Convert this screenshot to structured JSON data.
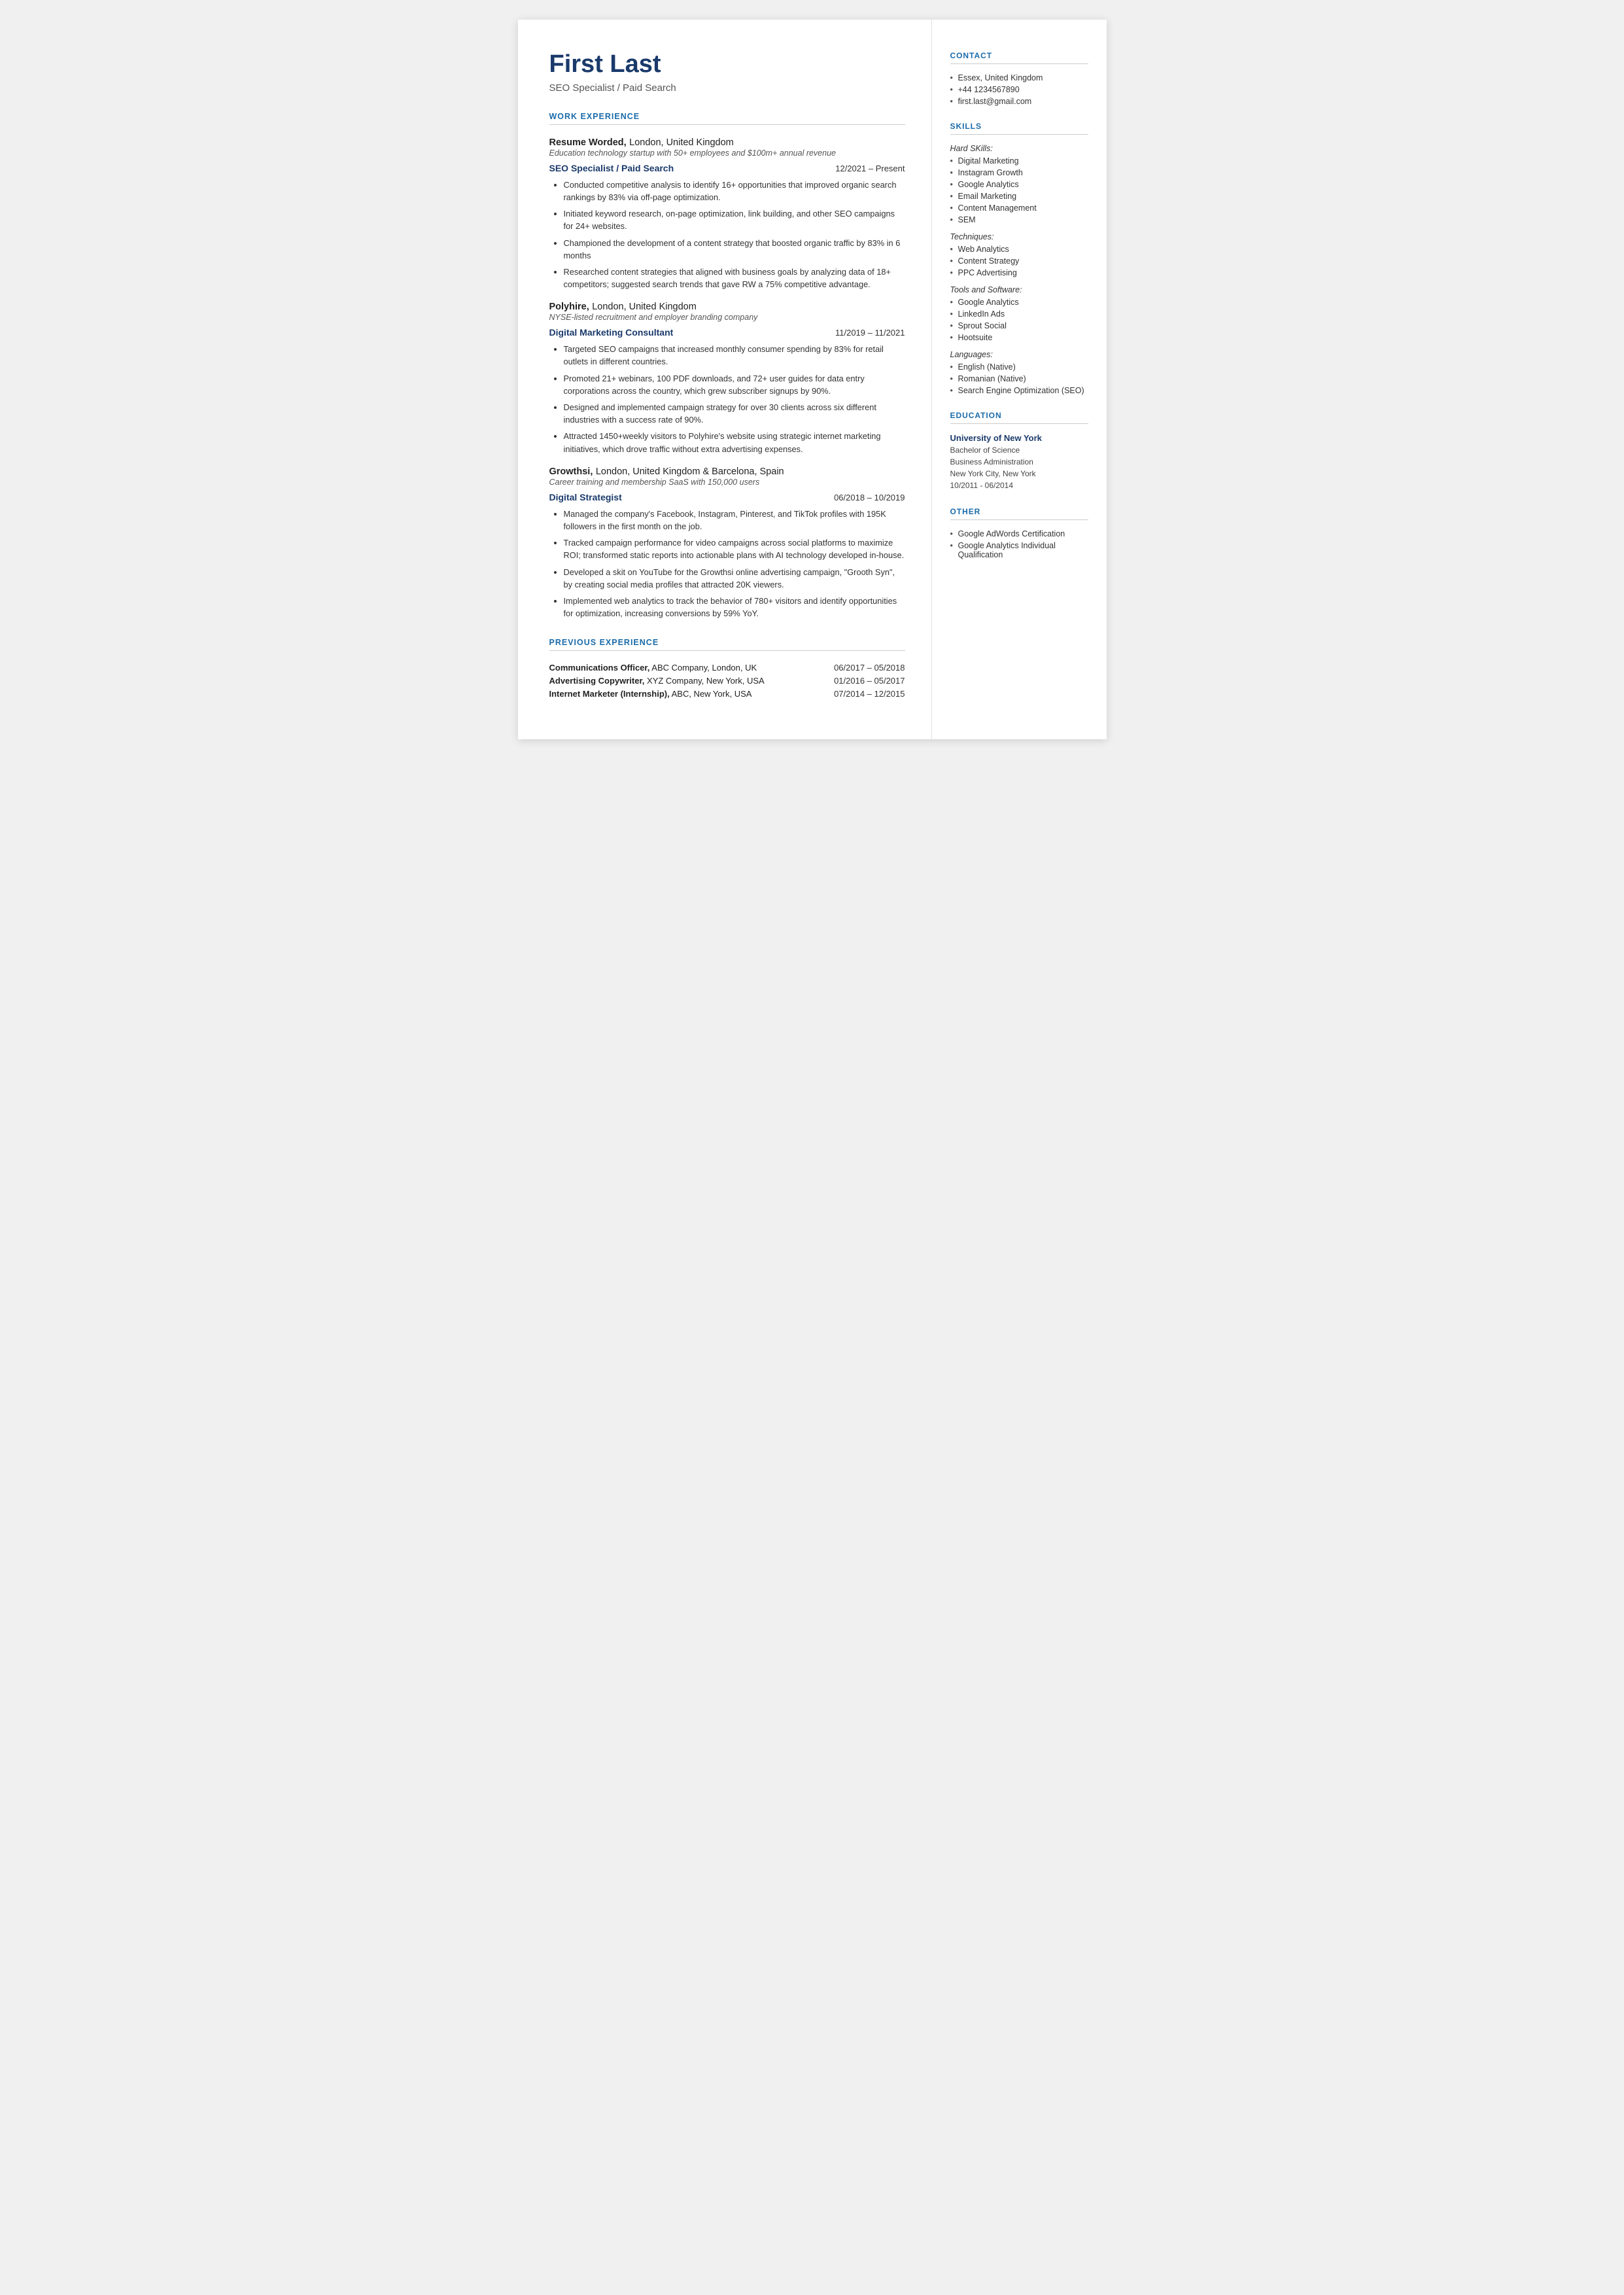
{
  "header": {
    "name": "First Last",
    "job_title": "SEO Specialist / Paid Search"
  },
  "sections": {
    "work_experience_label": "WORK EXPERIENCE",
    "previous_experience_label": "PREVIOUS EXPERIENCE"
  },
  "companies": [
    {
      "name": "Resume Worded,",
      "location": " London, United Kingdom",
      "description": "Education technology startup with 50+ employees and $100m+ annual revenue",
      "roles": [
        {
          "title": "SEO Specialist / Paid Search",
          "dates": "12/2021 – Present",
          "bullets": [
            "Conducted competitive analysis to identify 16+ opportunities that improved organic search rankings by 83% via off-page optimization.",
            "Initiated keyword research, on-page optimization, link building, and other SEO campaigns for 24+ websites.",
            "Championed the development of a content strategy that boosted organic traffic by 83% in 6 months",
            "Researched content strategies that aligned with business goals by analyzing data of 18+ competitors; suggested search trends that gave RW a 75% competitive advantage."
          ]
        }
      ]
    },
    {
      "name": "Polyhire,",
      "location": " London, United Kingdom",
      "description": "NYSE-listed recruitment and employer branding company",
      "roles": [
        {
          "title": "Digital Marketing Consultant",
          "dates": "11/2019 – 11/2021",
          "bullets": [
            "Targeted SEO campaigns that increased monthly consumer spending by 83% for retail outlets in different countries.",
            "Promoted 21+ webinars, 100 PDF downloads, and 72+ user guides for data entry corporations across the country, which grew subscriber signups by 90%.",
            "Designed and implemented campaign strategy for over 30 clients across six different industries with a success rate of 90%.",
            "Attracted 1450+weekly visitors to Polyhire's website using strategic internet marketing initiatives, which drove traffic without extra advertising expenses."
          ]
        }
      ]
    },
    {
      "name": "Growthsi,",
      "location": " London, United Kingdom & Barcelona, Spain",
      "description": "Career training and membership SaaS with 150,000 users",
      "roles": [
        {
          "title": "Digital Strategist",
          "dates": "06/2018 – 10/2019",
          "bullets": [
            "Managed the company's Facebook, Instagram, Pinterest, and TikTok profiles with 195K followers in the first month on the job.",
            "Tracked campaign performance for video campaigns across social platforms to maximize ROI; transformed static reports into actionable plans with AI technology developed in-house.",
            "Developed a skit on YouTube for the Growthsi online advertising campaign, \"Grooth Syn\", by creating social media profiles that attracted 20K viewers.",
            "Implemented web analytics to track the behavior of 780+ visitors and identify opportunities for optimization, increasing conversions by 59% YoY."
          ]
        }
      ]
    }
  ],
  "previous_experience": [
    {
      "role_bold": "Communications Officer,",
      "role_rest": " ABC Company, London, UK",
      "dates": "06/2017 – 05/2018"
    },
    {
      "role_bold": "Advertising Copywriter,",
      "role_rest": " XYZ Company, New York, USA",
      "dates": "01/2016 – 05/2017"
    },
    {
      "role_bold": "Internet Marketer (Internship),",
      "role_rest": " ABC, New York, USA",
      "dates": "07/2014 – 12/2015"
    }
  ],
  "sidebar": {
    "contact_label": "CONTACT",
    "contact_items": [
      "Essex, United Kingdom",
      "+44 1234567890",
      "first.last@gmail.com"
    ],
    "skills_label": "SKILLS",
    "hard_skills_label": "Hard SKills:",
    "hard_skills": [
      "Digital Marketing",
      "Instagram Growth",
      "Google Analytics",
      "Email Marketing",
      "Content Management",
      "SEM"
    ],
    "techniques_label": "Techniques:",
    "techniques": [
      "Web Analytics",
      "Content Strategy",
      "PPC Advertising"
    ],
    "tools_label": "Tools and Software:",
    "tools": [
      "Google Analytics",
      "LinkedIn Ads",
      "Sprout Social",
      "Hootsuite"
    ],
    "languages_label": "Languages:",
    "languages": [
      "English (Native)",
      "Romanian (Native)",
      "Search Engine Optimization (SEO)"
    ],
    "education_label": "EDUCATION",
    "education": [
      {
        "university": "University of New York",
        "degree": "Bachelor of Science",
        "field": "Business Administration",
        "location": "New York City, New York",
        "dates": "10/2011 - 06/2014"
      }
    ],
    "other_label": "OTHER",
    "other_items": [
      "Google AdWords Certification",
      "Google Analytics Individual Qualification"
    ]
  }
}
